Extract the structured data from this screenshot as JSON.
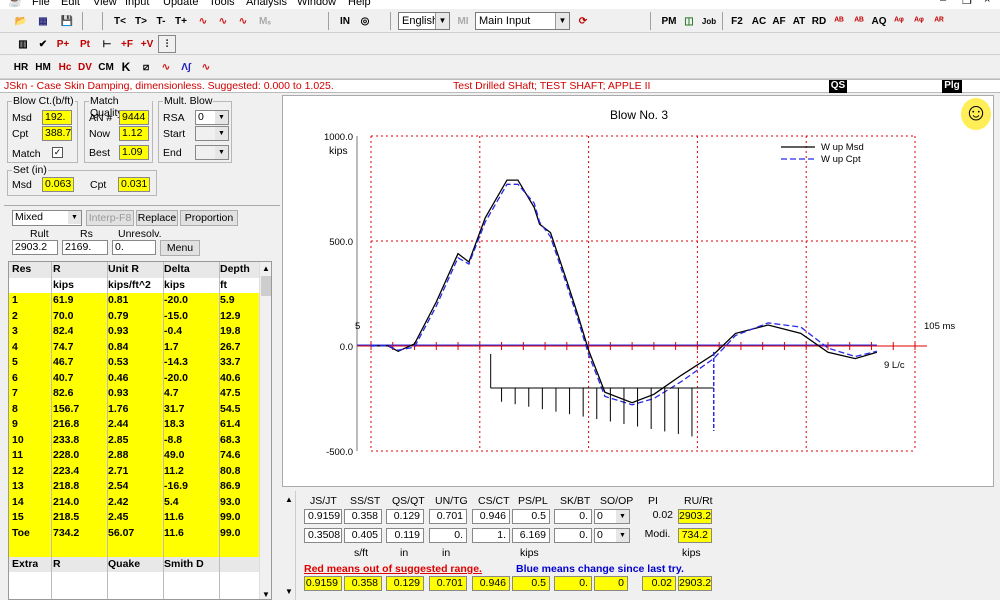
{
  "menu": [
    "File",
    "Edit",
    "View",
    "Input",
    "Update",
    "Tools",
    "Analysis",
    "Window",
    "Help"
  ],
  "toolbar1": {
    "lang_select": "English",
    "mi_label": "MI",
    "main_select": "Main Input",
    "in_label": "IN",
    "left_btns": [
      "T<",
      "T>",
      "T-",
      "T+"
    ],
    "right_btns": [
      "PM",
      "Job",
      "F2",
      "AC",
      "AF",
      "AT",
      "RD",
      "AQ"
    ]
  },
  "toolbar2": {
    "btns": [
      "P+",
      "Pt",
      "+F",
      "+V"
    ]
  },
  "toolbar3": {
    "btns": [
      "HR",
      "HM",
      "Hc",
      "DV",
      "CM",
      "K"
    ]
  },
  "status": {
    "left": "JSkn - Case Skin Damping, dimensionless. Suggested: 0.000 to 1.025.",
    "center": "Test Drilled SHaft; TEST SHAFT; APPLE II",
    "qs": "QS",
    "plg": "Plg"
  },
  "blowct": {
    "title": "Blow Ct.(b/ft)",
    "msd_label": "Msd",
    "msd_value": "192.",
    "cpt_label": "Cpt",
    "cpt_value": "388.7",
    "match_label": "Match"
  },
  "matchq": {
    "title": "Match Quality",
    "an_label": "AN #",
    "an_value": "9444",
    "now_label": "Now",
    "now_value": "1.12",
    "best_label": "Best",
    "best_value": "1.09"
  },
  "multblow": {
    "title": "Mult. Blow",
    "rsa_label": "RSA",
    "rsa_value": "0",
    "start_label": "Start",
    "end_label": "End"
  },
  "set": {
    "title": "Set (in)",
    "msd_label": "Msd",
    "msd_value": "0.063",
    "cpt_label": "Cpt",
    "cpt_value": "0.031"
  },
  "resist": {
    "mode": "Mixed",
    "interp": "Interp-F8",
    "replace": "Replace",
    "proportion": "Proportion",
    "rult_label": "Rult",
    "rs_label": "Rs",
    "unresolv_label": "Unresolv.",
    "rult": "2903.2",
    "rs": "2169.",
    "unresolv": "0.",
    "menu_btn": "Menu"
  },
  "table": {
    "headers": [
      "Res",
      "R",
      "Unit R",
      "Delta",
      "Depth"
    ],
    "units": [
      "",
      "kips",
      "kips/ft^2",
      "kips",
      "ft"
    ],
    "rows": [
      [
        "1",
        "61.9",
        "0.81",
        "-20.0",
        "5.9"
      ],
      [
        "2",
        "70.0",
        "0.79",
        "-15.0",
        "12.9"
      ],
      [
        "3",
        "82.4",
        "0.93",
        "-0.4",
        "19.8"
      ],
      [
        "4",
        "74.7",
        "0.84",
        "1.7",
        "26.7"
      ],
      [
        "5",
        "46.7",
        "0.53",
        "-14.3",
        "33.7"
      ],
      [
        "6",
        "40.7",
        "0.46",
        "-20.0",
        "40.6"
      ],
      [
        "7",
        "82.6",
        "0.93",
        "4.7",
        "47.5"
      ],
      [
        "8",
        "156.7",
        "1.76",
        "31.7",
        "54.5"
      ],
      [
        "9",
        "216.8",
        "2.44",
        "18.3",
        "61.4"
      ],
      [
        "10",
        "233.8",
        "2.85",
        "-8.8",
        "68.3"
      ],
      [
        "11",
        "228.0",
        "2.88",
        "49.0",
        "74.6"
      ],
      [
        "12",
        "223.4",
        "2.71",
        "11.2",
        "80.8"
      ],
      [
        "13",
        "218.8",
        "2.54",
        "-16.9",
        "86.9"
      ],
      [
        "14",
        "214.0",
        "2.42",
        "5.4",
        "93.0"
      ],
      [
        "15",
        "218.5",
        "2.45",
        "11.6",
        "99.0"
      ]
    ],
    "toe": [
      "Toe",
      "734.2",
      "56.07",
      "11.6",
      "99.0"
    ],
    "extra": [
      "Extra",
      "R",
      "Quake",
      "Smith D",
      ""
    ]
  },
  "chart_data": {
    "type": "line",
    "title": "Blow No. 3",
    "ylabel": "kips",
    "yticks": [
      "1000.0",
      "500.0",
      "0.0",
      "-500.0"
    ],
    "ylim": [
      -500,
      1000
    ],
    "start_label": "5",
    "end_label": "105 ms",
    "lc_label": "9 L/c",
    "series": [
      {
        "name": "W up Msd",
        "color": "#000000",
        "values": [
          [
            0,
            0
          ],
          [
            3,
            2
          ],
          [
            5,
            -25
          ],
          [
            8,
            10
          ],
          [
            12,
            210
          ],
          [
            16,
            440
          ],
          [
            18,
            400
          ],
          [
            21,
            610
          ],
          [
            25,
            790
          ],
          [
            27,
            790
          ],
          [
            30,
            660
          ],
          [
            31,
            580
          ],
          [
            33,
            540
          ],
          [
            36,
            310
          ],
          [
            38,
            150
          ],
          [
            40,
            -20
          ],
          [
            43,
            -220
          ],
          [
            48,
            -270
          ],
          [
            52,
            -230
          ],
          [
            57,
            -140
          ],
          [
            63,
            -40
          ],
          [
            67,
            60
          ],
          [
            73,
            100
          ],
          [
            79,
            60
          ],
          [
            84,
            -30
          ],
          [
            89,
            -60
          ],
          [
            93,
            -30
          ]
        ]
      },
      {
        "name": "W up Cpt",
        "color": "#2a2ae6",
        "values": [
          [
            0,
            0
          ],
          [
            3,
            2
          ],
          [
            5,
            -20
          ],
          [
            8,
            -5
          ],
          [
            12,
            190
          ],
          [
            16,
            420
          ],
          [
            18,
            390
          ],
          [
            21,
            590
          ],
          [
            25,
            770
          ],
          [
            27,
            770
          ],
          [
            30,
            680
          ],
          [
            31,
            590
          ],
          [
            33,
            520
          ],
          [
            36,
            290
          ],
          [
            38,
            130
          ],
          [
            40,
            -40
          ],
          [
            43,
            -240
          ],
          [
            48,
            -280
          ],
          [
            52,
            -250
          ],
          [
            57,
            -170
          ],
          [
            63,
            -60
          ],
          [
            67,
            50
          ],
          [
            73,
            110
          ],
          [
            79,
            90
          ],
          [
            84,
            -10
          ],
          [
            89,
            -50
          ],
          [
            93,
            -25
          ]
        ]
      }
    ]
  },
  "params": {
    "headers": [
      "JS/JT",
      "SS/ST",
      "QS/QT",
      "UN/TG",
      "CS/CT",
      "PS/PL",
      "SK/BT",
      "SO/OP",
      "PI",
      "RU/Rt"
    ],
    "row1": [
      "0.9159",
      "0.358",
      "0.129",
      "0.701",
      "0.946",
      "0.5",
      "0.",
      "0",
      "0.02",
      "2903.2"
    ],
    "row2": [
      "0.3508",
      "0.405",
      "0.119",
      "0.",
      "1.",
      "6.169",
      "0.",
      "0",
      "Modi.",
      "734.2"
    ],
    "units": [
      "s/ft",
      "in",
      "in",
      "kips",
      "kips"
    ],
    "red_note": "Red means out of suggested range.",
    "blue_note": "Blue means change since last try.",
    "row3": [
      "0.9159",
      "0.358",
      "0.129",
      "0.701",
      "0.946",
      "0.5",
      "0.",
      "0",
      "0.02",
      "2903.2"
    ]
  }
}
